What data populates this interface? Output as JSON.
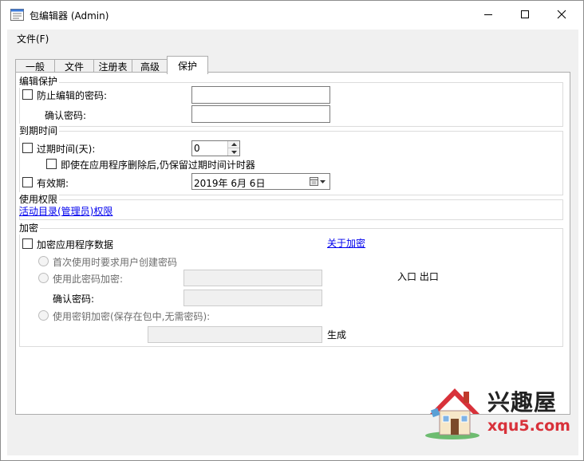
{
  "window": {
    "title": "包编辑器 (Admin)"
  },
  "menu": {
    "file": "文件(F)"
  },
  "tabs": [
    {
      "label": "一般"
    },
    {
      "label": "文件"
    },
    {
      "label": "注册表"
    },
    {
      "label": "高级"
    },
    {
      "label": "保护"
    }
  ],
  "edit_protection": {
    "title": "编辑保护",
    "prevent_label": "防止编辑的密码:",
    "prevent_checked": false,
    "password_value": "",
    "confirm_label": "确认密码:",
    "confirm_value": ""
  },
  "expiration": {
    "title": "到期时间",
    "expire_days_label": "过期时间(天):",
    "expire_days_checked": false,
    "expire_days_value": "0",
    "keep_timer_label": "即使在应用程序删除后,仍保留过期时间计时器",
    "keep_timer_checked": false,
    "valid_label": "有效期:",
    "valid_checked": false,
    "valid_date": "2019年  6月  6日"
  },
  "permissions": {
    "title": "使用权限",
    "ad_link": "活动目录(管理员)权限"
  },
  "encryption": {
    "title": "加密",
    "encrypt_label": "加密应用程序数据",
    "encrypt_checked": false,
    "about_link": "关于加密",
    "opt_first_use": "首次使用时要求用户创建密码",
    "opt_password": "使用此密码加密:",
    "password_value": "",
    "confirm_label": "确认密码:",
    "confirm_value": "",
    "in_out": "入口 出口",
    "opt_key": "使用密钥加密(保存在包中,无需密码):",
    "key_value": "",
    "generate": "生成"
  },
  "watermark": {
    "cn": "兴趣屋",
    "url": "xqu5.com"
  },
  "colors": {
    "link": "#0000ee",
    "background": "#f0f0f0",
    "panel": "#ffffff"
  }
}
